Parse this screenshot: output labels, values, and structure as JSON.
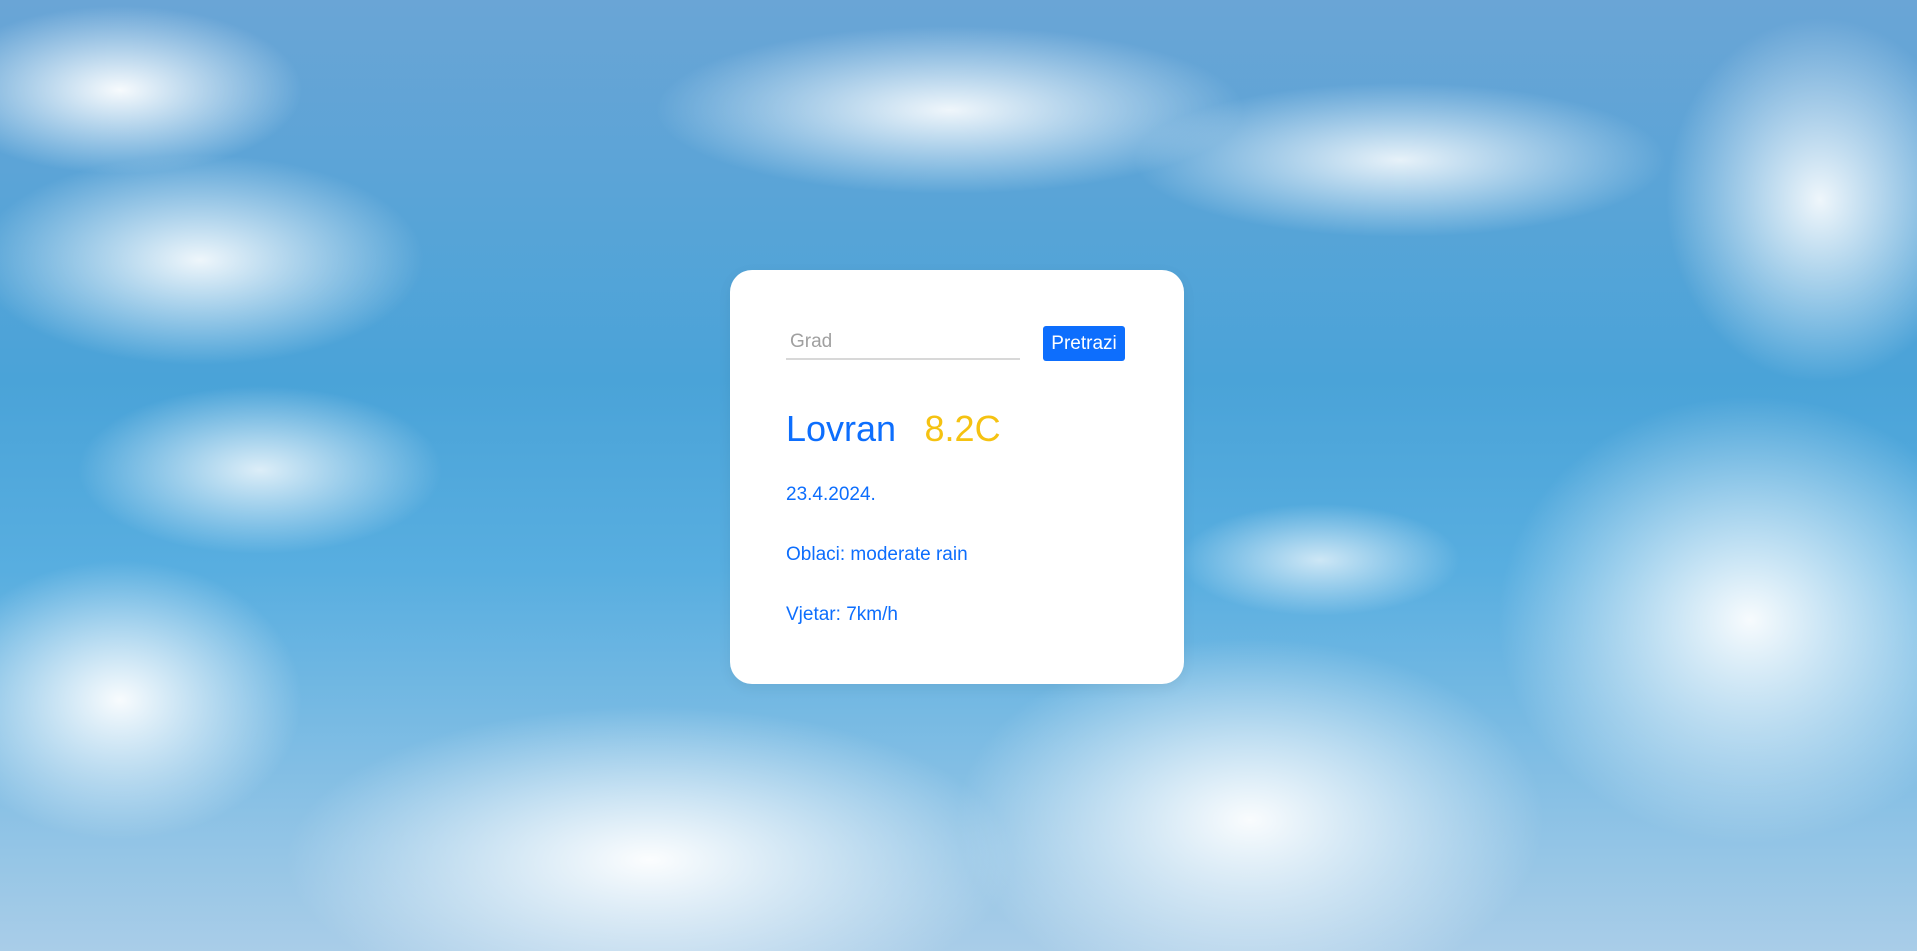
{
  "search": {
    "placeholder": "Grad",
    "value": "",
    "button_label": "Pretrazi"
  },
  "weather": {
    "city": "Lovran",
    "temperature": "8.2C",
    "date": "23.4.2024.",
    "clouds_label": "Oblaci:",
    "clouds_value": "moderate rain",
    "wind_label": "Vjetar:",
    "wind_value": "7km/h"
  },
  "colors": {
    "accent": "#0d6efd",
    "temperature": "#f5c211",
    "card_background": "#ffffff"
  }
}
